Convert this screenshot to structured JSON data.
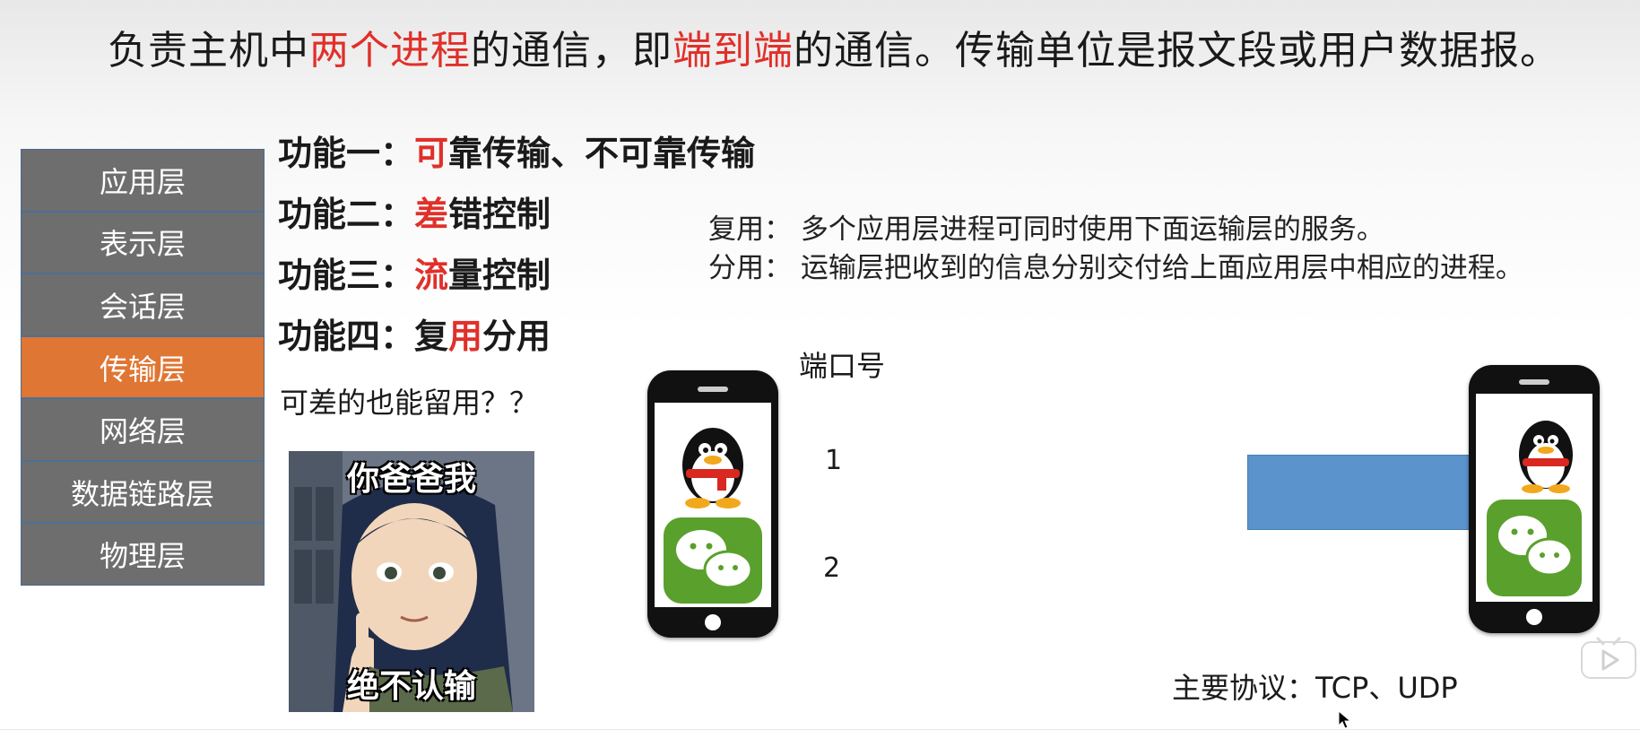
{
  "headline": {
    "part1": "负责主机中",
    "hl1": "两个进程",
    "part2": "的通信，即",
    "hl2": "端到端",
    "part3": "的通信。传输单位是报文段或用户数据报。"
  },
  "layers": [
    {
      "label": "应用层",
      "active": false
    },
    {
      "label": "表示层",
      "active": false
    },
    {
      "label": "会话层",
      "active": false
    },
    {
      "label": "传输层",
      "active": true
    },
    {
      "label": "网络层",
      "active": false
    },
    {
      "label": "数据链路层",
      "active": false
    },
    {
      "label": "物理层",
      "active": false
    }
  ],
  "functions": {
    "f1": {
      "prefix": "功能一：",
      "hl": "可",
      "rest": "靠传输、不可靠传输"
    },
    "f2": {
      "prefix": "功能二：",
      "hl": "差",
      "rest": "错控制"
    },
    "f3": {
      "prefix": "功能三：",
      "hl": "流",
      "rest": "量控制"
    },
    "f4": {
      "prefix": "功能四：复",
      "hl": "用",
      "rest": "分用"
    }
  },
  "question": "可差的也能留用？？",
  "meme": {
    "top_caption": "你爸爸我",
    "bottom_caption": "绝不认输"
  },
  "mux": {
    "line1": "复用：  多个应用层进程可同时使用下面运输层的服务。",
    "line2": "分用：  运输层把收到的信息分别交付给上面应用层中相应的进程。"
  },
  "ports": {
    "label": "端口号",
    "p1": "1",
    "p2": "2"
  },
  "protocols": "主要协议：TCP、UDP",
  "colors": {
    "accent_red": "#e0302a",
    "active_layer": "#e07633",
    "layer_bg": "#6e6e6e",
    "blue_box": "#5b93cc",
    "wechat_green": "#5aa02c"
  },
  "icons": [
    "qq-penguin-icon",
    "wechat-icon",
    "mouse-cursor-icon",
    "play-icon"
  ]
}
